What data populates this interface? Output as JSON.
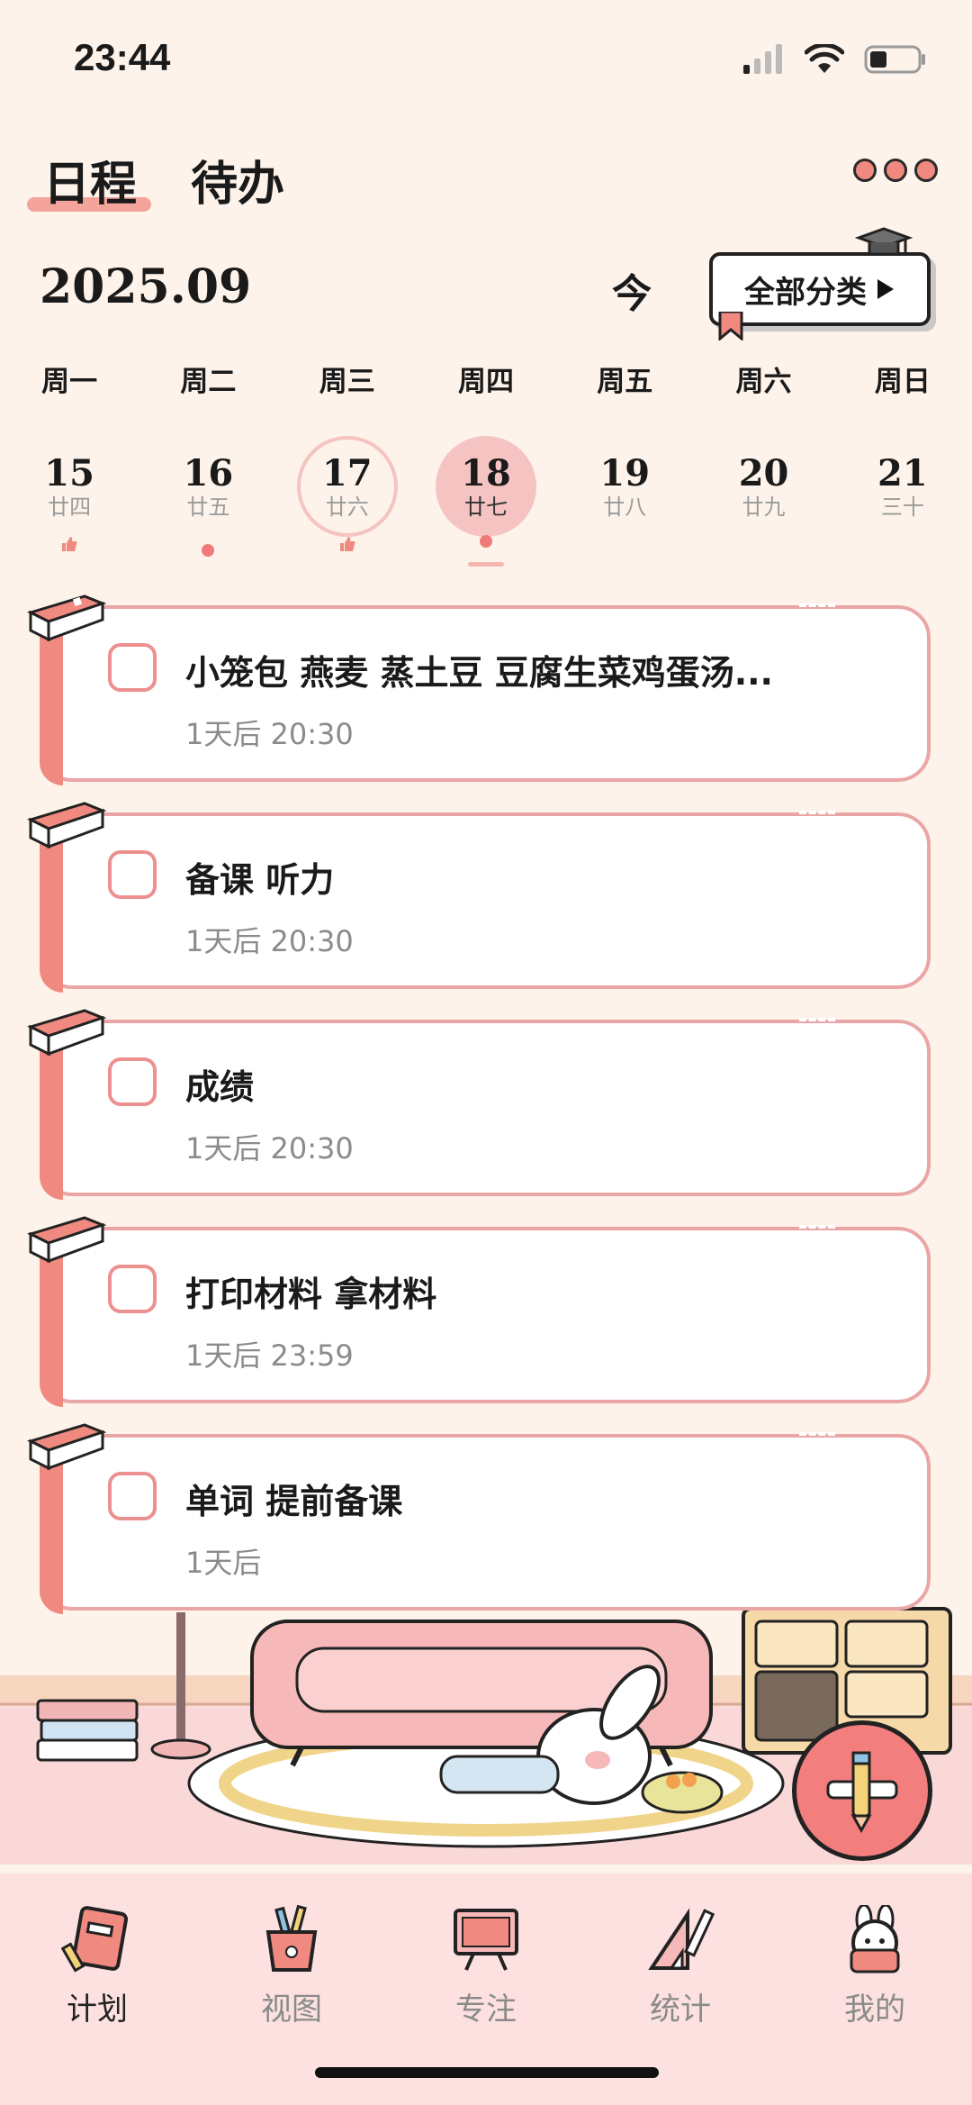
{
  "status": {
    "time": "23:44"
  },
  "header": {
    "tabs": [
      {
        "label": "日程"
      },
      {
        "label": "待办"
      }
    ],
    "month": "2025.09",
    "today_label": "今",
    "category_label": "全部分类"
  },
  "week": {
    "weekdays": [
      "周一",
      "周二",
      "周三",
      "周四",
      "周五",
      "周六",
      "周日"
    ],
    "dates": [
      {
        "num": "15",
        "lunar": "廿四",
        "mark": "thumb"
      },
      {
        "num": "16",
        "lunar": "廿五",
        "mark": "dot"
      },
      {
        "num": "17",
        "lunar": "廿六",
        "mark": "thumb",
        "state": "today"
      },
      {
        "num": "18",
        "lunar": "廿七",
        "mark": "dot",
        "state": "selected"
      },
      {
        "num": "19",
        "lunar": "廿八"
      },
      {
        "num": "20",
        "lunar": "廿九"
      },
      {
        "num": "21",
        "lunar": "三十"
      }
    ]
  },
  "tasks": [
    {
      "title": "小笼包  燕麦 蒸土豆 豆腐生菜鸡蛋汤...",
      "due": "1天后 20:30"
    },
    {
      "title": "备课 听力",
      "due": "1天后 20:30"
    },
    {
      "title": "成绩",
      "due": "1天后 20:30"
    },
    {
      "title": "打印材料 拿材料",
      "due": "1天后 23:59"
    },
    {
      "title": "单词 提前备课",
      "due": "1天后"
    }
  ],
  "nav": {
    "items": [
      {
        "label": "计划",
        "icon": "planner-book-icon",
        "active": true
      },
      {
        "label": "视图",
        "icon": "pencil-cup-icon"
      },
      {
        "label": "专注",
        "icon": "chalkboard-icon"
      },
      {
        "label": "统计",
        "icon": "ruler-triangle-icon"
      },
      {
        "label": "我的",
        "icon": "bunny-avatar-icon"
      }
    ]
  },
  "colors": {
    "accent": "#f08a80",
    "background": "#fdf3ea",
    "card_border": "#eaa6a6"
  }
}
